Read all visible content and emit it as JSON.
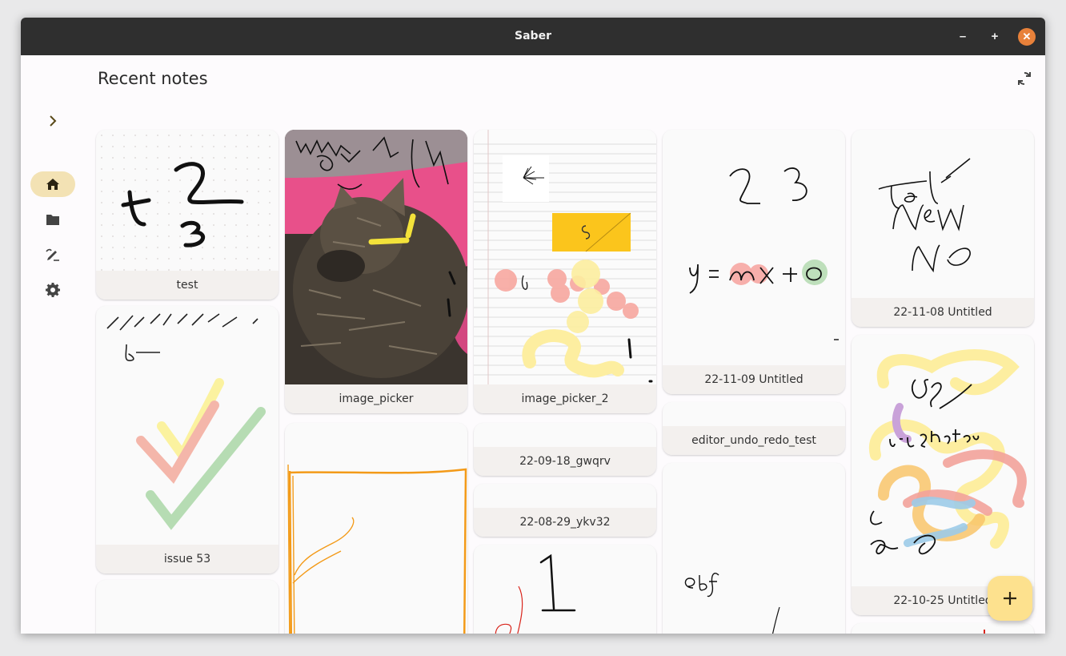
{
  "window": {
    "title": "Saber",
    "minimize": "–",
    "maximize": "+",
    "close": "✕"
  },
  "page": {
    "title": "Recent notes"
  },
  "nav": [
    "home-icon",
    "folder-icon",
    "whiteboard-icon",
    "settings-icon"
  ],
  "notes": [
    {
      "name": "test"
    },
    {
      "name": "issue 53"
    },
    {
      "name": "image_picker"
    },
    {
      "name": "image_picker_2"
    },
    {
      "name": "22-09-18_gwqrv"
    },
    {
      "name": "22-08-29_ykv32"
    },
    {
      "name": "22-11-09 Untitled"
    },
    {
      "name": "editor_undo_redo_test"
    },
    {
      "name": "22-11-08 Untitled"
    },
    {
      "name": "22-10-25 Untitled"
    }
  ],
  "fab": {
    "icon": "+"
  },
  "colors": {
    "accent": "#f3e2b4",
    "fab": "#fde18e",
    "titlebar": "#2f2f2f",
    "close": "#e8813a"
  }
}
